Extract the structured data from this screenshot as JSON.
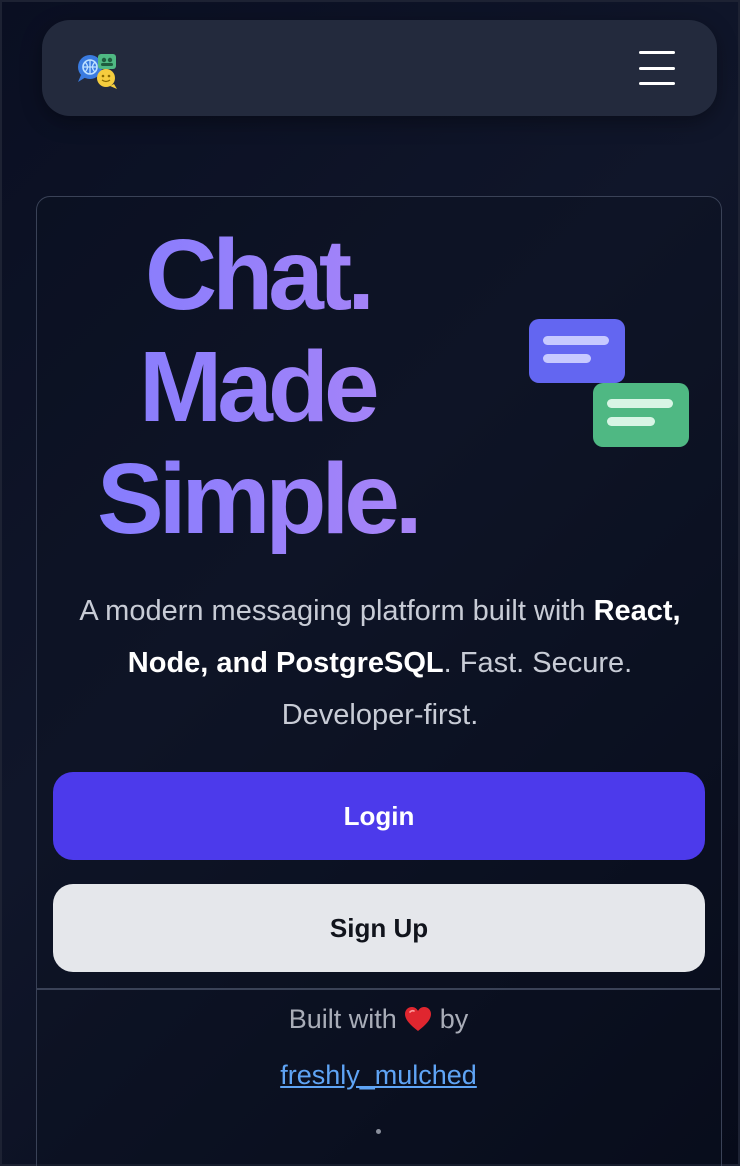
{
  "nav": {
    "logo": "chat-logo",
    "menu_icon": "hamburger-menu-icon"
  },
  "hero": {
    "headline": [
      "Chat.",
      "Made",
      "Simple."
    ],
    "tagline_pre": "A modern messaging platform built with ",
    "tagline_bold": "React, Node, and PostgreSQL",
    "tagline_post": ". Fast. Secure. Developer-first.",
    "illustration": "chat-bubbles-icon",
    "colors": {
      "headline_gradient_start": "#7f7bff",
      "headline_gradient_end": "#b387f5",
      "bubble_primary": "#6366f1",
      "bubble_secondary": "#4fb883"
    }
  },
  "actions": {
    "login_label": "Login",
    "signup_label": "Sign Up",
    "login_color": "#4c3aeb",
    "signup_color": "#e5e7eb"
  },
  "footer": {
    "built_with_pre": "Built with",
    "built_with_post": "by",
    "heart_icon": "heart-icon",
    "author": "freshly_mulched"
  }
}
